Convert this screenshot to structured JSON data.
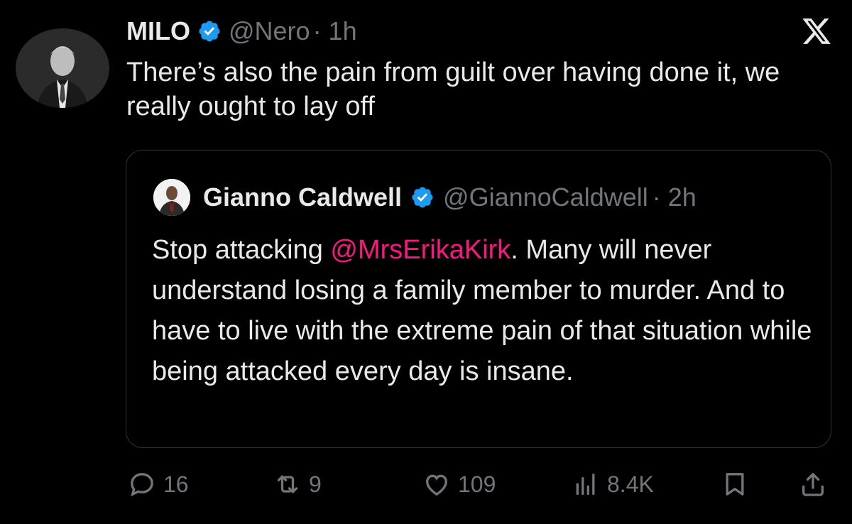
{
  "author": {
    "name": "MILO",
    "handle": "@Nero",
    "time": "· 1h",
    "text": "There’s also the pain from guilt over having done it, we really ought to lay off"
  },
  "quoted": {
    "name": "Gianno Caldwell",
    "handle": "@GiannoCaldwell",
    "time": "· 2h",
    "text_before": "Stop attacking ",
    "mention": "@MrsErikaKirk",
    "text_after": ". Many will never understand losing a family member to murder. And to have to live with the extreme pain of that situation while being attacked every day is insane."
  },
  "actions": {
    "replies": "16",
    "reposts": "9",
    "likes": "109",
    "views": "8.4K"
  },
  "colors": {
    "background": "#000000",
    "text": "#e7e9ea",
    "secondary": "#71767b",
    "verified": "#1d9bf0",
    "mention": "#f91880",
    "border": "#2f3336"
  },
  "icons": [
    "x-logo-icon",
    "verified-icon",
    "reply-icon",
    "repost-icon",
    "like-icon",
    "views-icon",
    "bookmark-icon",
    "share-icon"
  ]
}
